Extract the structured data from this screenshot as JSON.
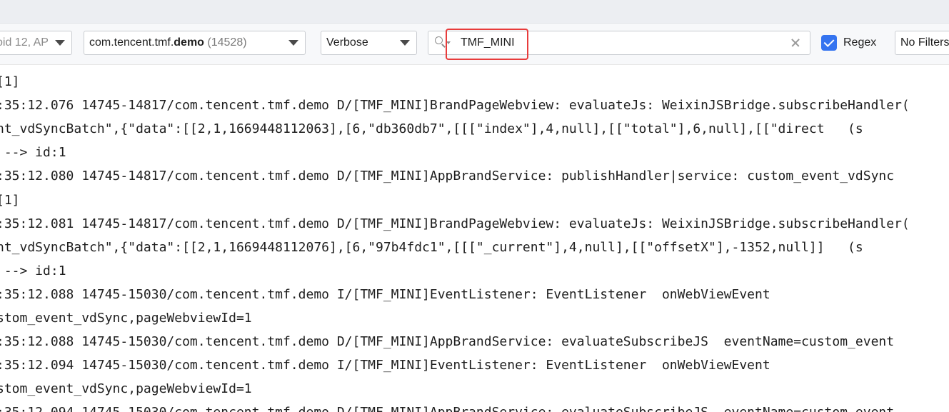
{
  "toolbar": {
    "device": "oid 12, AP",
    "process": {
      "prefix": "com.tencent.tmf.",
      "bold": "demo",
      "pid": "(14528)"
    },
    "level": "Verbose",
    "search": {
      "value": "TMF_MINI"
    },
    "regex_label": "Regex",
    "regex_checked": true,
    "filters": "No Filters"
  },
  "colors": {
    "accent": "#3574f0",
    "highlight": "#e83b3b"
  },
  "log": {
    "lines": [
      "[1]",
      ":35:12.076 14745-14817/com.tencent.tmf.demo D/[TMF_MINI]BrandPageWebview: evaluateJs: WeixinJSBridge.subscribeHandler(",
      "nt_vdSyncBatch\",{\"data\":[[2,1,1669448112063],[6,\"db360db7\",[[[\"index\"],4,null],[[\"total\"],6,null],[[\"direct   (s",
      " --> id:1",
      ":35:12.080 14745-14817/com.tencent.tmf.demo D/[TMF_MINI]AppBrandService: publishHandler|service: custom_event_vdSync",
      "[1]",
      ":35:12.081 14745-14817/com.tencent.tmf.demo D/[TMF_MINI]BrandPageWebview: evaluateJs: WeixinJSBridge.subscribeHandler(",
      "nt_vdSyncBatch\",{\"data\":[[2,1,1669448112076],[6,\"97b4fdc1\",[[[\"_current\"],4,null],[[\"offsetX\"],-1352,null]]   (s",
      " --> id:1",
      ":35:12.088 14745-15030/com.tencent.tmf.demo I/[TMF_MINI]EventListener: EventListener  onWebViewEvent",
      "stom_event_vdSync,pageWebviewId=1",
      ":35:12.088 14745-15030/com.tencent.tmf.demo D/[TMF_MINI]AppBrandService: evaluateSubscribeJS  eventName=custom_event",
      ":35:12.094 14745-15030/com.tencent.tmf.demo I/[TMF_MINI]EventListener: EventListener  onWebViewEvent",
      "stom_event_vdSync,pageWebviewId=1",
      ":35:12.094 14745-15030/com.tencent.tmf.demo D/[TMF_MINI]AppBrandService: evaluateSubscribeJS  eventName=custom_event"
    ]
  }
}
